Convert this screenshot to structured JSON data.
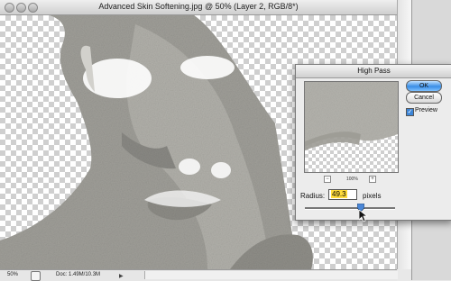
{
  "document": {
    "title": "Advanced Skin Softening.jpg @ 50% (Layer 2, RGB/8*)"
  },
  "status_bar": {
    "zoom": "50%",
    "doc_size": "Doc: 1.49M/10.3M"
  },
  "dialog": {
    "title": "High Pass",
    "ok_label": "OK",
    "cancel_label": "Cancel",
    "preview_label": "Preview",
    "preview_checked": true,
    "preview_zoom": "100%",
    "radius_label": "Radius:",
    "radius_value": "49.3",
    "radius_units": "pixels"
  },
  "colors": {
    "ok_button": "#3a8ee6",
    "radius_highlight": "#ffdc3c"
  },
  "icons": [
    "close-icon",
    "minimize-icon",
    "zoom-icon",
    "zoom-out-icon",
    "zoom-in-icon",
    "slider-thumb-icon",
    "cursor-icon",
    "checkbox-icon",
    "status-menu-icon",
    "chevron-right-icon"
  ]
}
